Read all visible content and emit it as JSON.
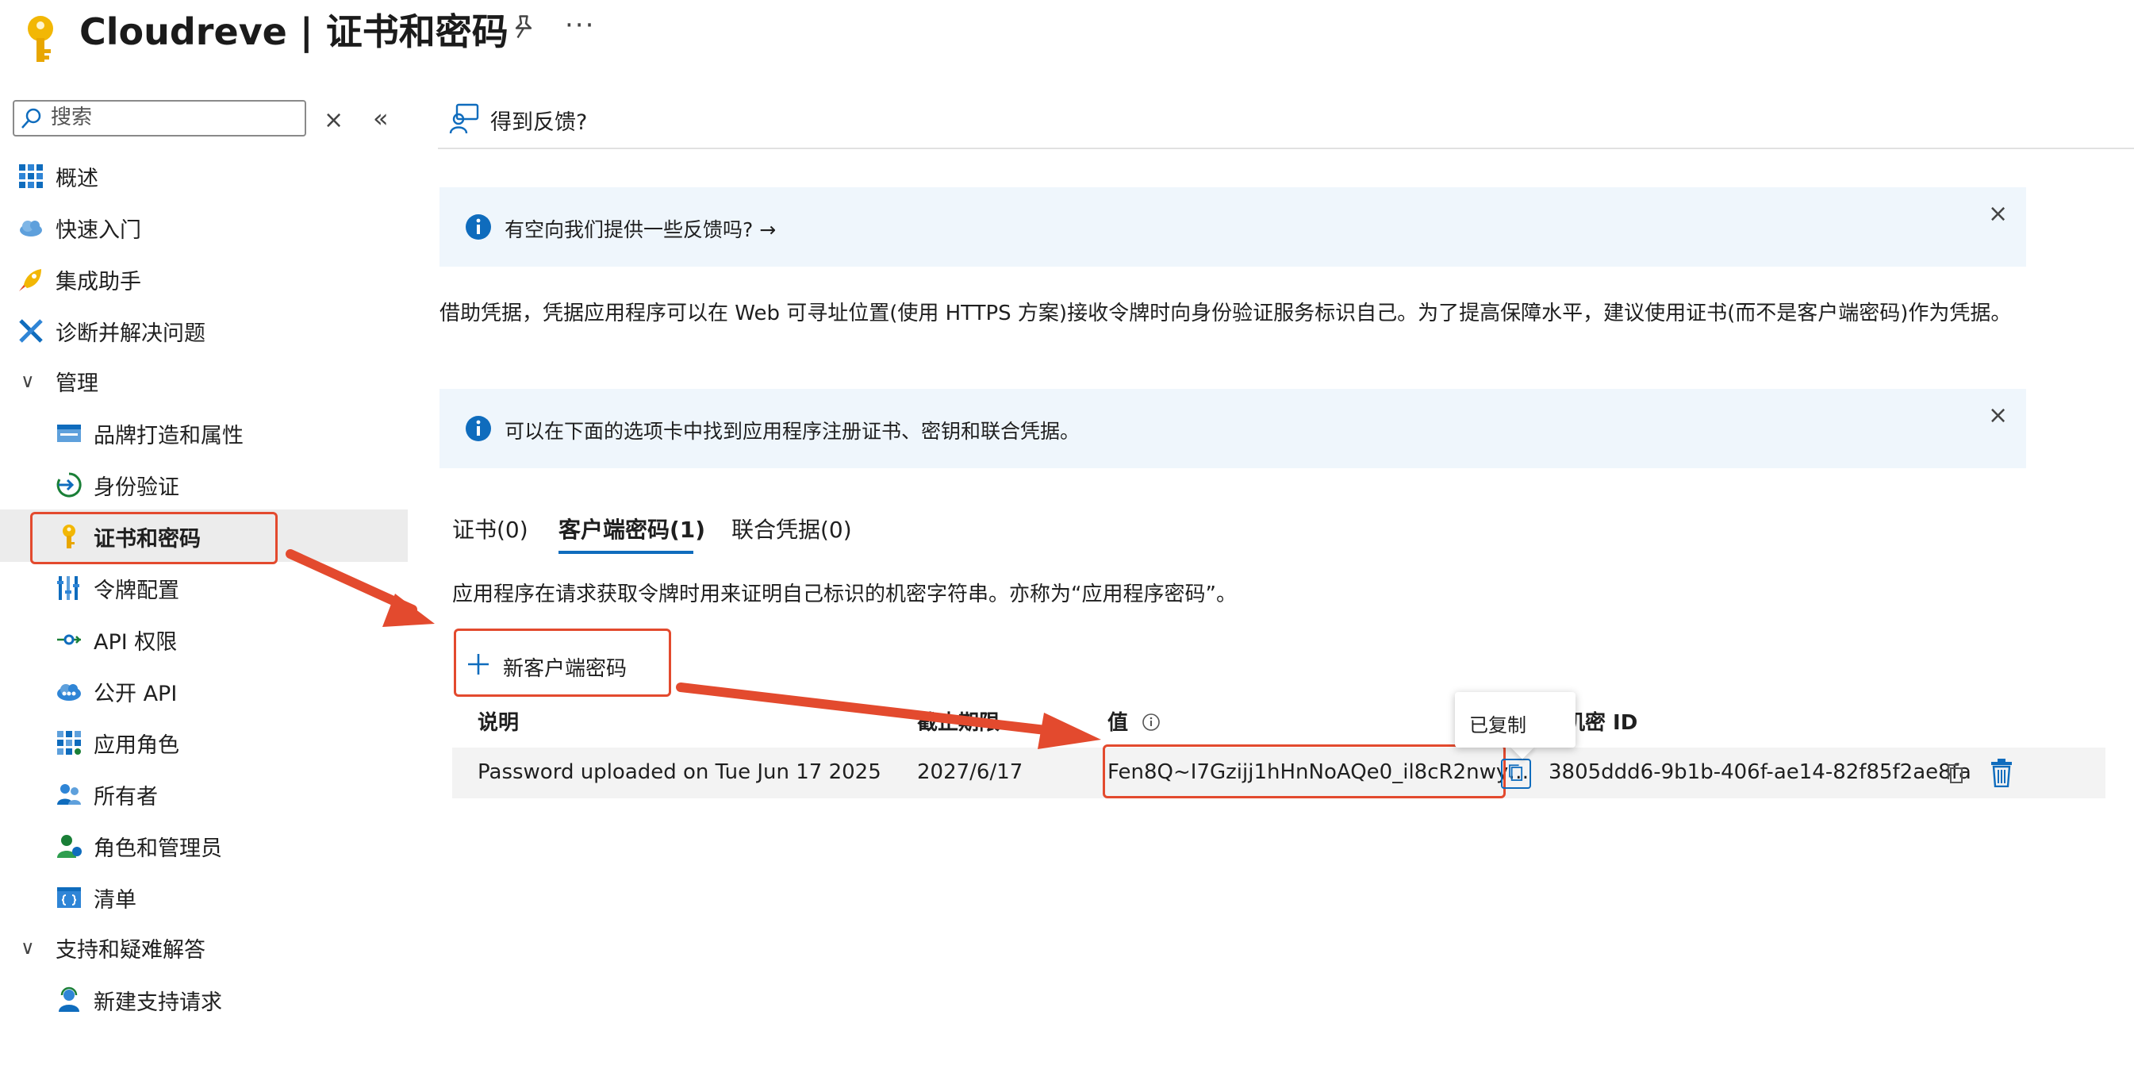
{
  "header": {
    "title": "Cloudreve | 证书和密码",
    "more_label": "···"
  },
  "sidebar": {
    "search_placeholder": "搜索",
    "clear_glyph": "×",
    "collapse_glyph": "«",
    "items": [
      {
        "label": "概述",
        "icon": "overview-grid-icon"
      },
      {
        "label": "快速入门",
        "icon": "quickstart-cloud-icon"
      },
      {
        "label": "集成助手",
        "icon": "rocket-icon"
      },
      {
        "label": "诊断并解决问题",
        "icon": "wrench-icon"
      }
    ],
    "group_manage": "管理",
    "manage_items": [
      {
        "label": "品牌打造和属性",
        "icon": "branding-icon"
      },
      {
        "label": "身份验证",
        "icon": "authentication-icon"
      },
      {
        "label": "证书和密码",
        "icon": "key-icon"
      },
      {
        "label": "令牌配置",
        "icon": "token-bars-icon"
      },
      {
        "label": "API 权限",
        "icon": "api-permissions-icon"
      },
      {
        "label": "公开 API",
        "icon": "expose-api-cloud-icon"
      },
      {
        "label": "应用角色",
        "icon": "app-roles-grid-icon"
      },
      {
        "label": "所有者",
        "icon": "owners-people-icon"
      },
      {
        "label": "角色和管理员",
        "icon": "roles-admins-icon"
      },
      {
        "label": "清单",
        "icon": "manifest-icon"
      }
    ],
    "group_support": "支持和疑难解答",
    "support_items": [
      {
        "label": "新建支持请求",
        "icon": "support-person-icon"
      }
    ]
  },
  "main": {
    "feedback_label": "得到反馈?",
    "banner1": "有空向我们提供一些反馈吗? →",
    "description": "借助凭据，凭据应用程序可以在 Web 可寻址位置(使用 HTTPS 方案)接收令牌时向身份验证服务标识自己。为了提高保障水平，建议使用证书(而不是客户端密码)作为凭据。",
    "banner2": "可以在下面的选项卡中找到应用程序注册证书、密钥和联合凭据。",
    "close_glyph": "×",
    "tabs": [
      {
        "label": "证书(0)"
      },
      {
        "label": "客户端密码(1)"
      },
      {
        "label": "联合凭据(0)"
      }
    ],
    "section_description": "应用程序在请求获取令牌时用来证明自己标识的机密字符串。亦称为“应用程序密码”。",
    "new_secret_label": "新客户端密码",
    "table": {
      "headers": [
        "说明",
        "截止期限",
        "值",
        "机密 ID"
      ],
      "rows": [
        {
          "description": "Password uploaded on Tue Jun 17 2025",
          "expires": "2027/6/17",
          "value": "Fen8Q~I7Gzijj1hHnNoAQe0_il8cR2nwy…",
          "secret_id": "3805ddd6-9b1b-406f-ae14-82f85f2ae8fa"
        }
      ]
    },
    "tooltip": "已复制"
  },
  "colors": {
    "accent": "#0f6cbd",
    "annotation": "#e34a2e",
    "banner_bg": "#eff6fc",
    "key_yellow": "#f2b705"
  }
}
